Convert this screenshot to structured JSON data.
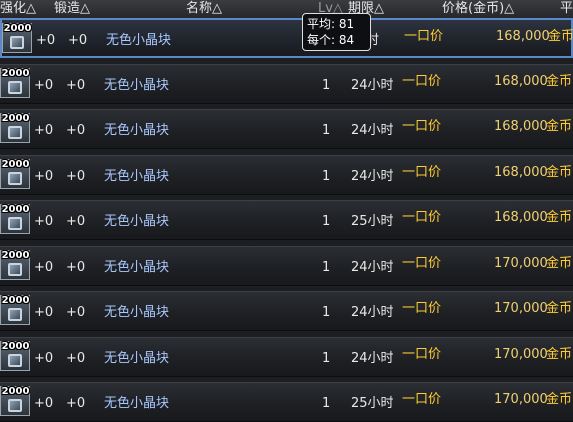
{
  "header": {
    "enhance": "强化△",
    "forge": "锻造△",
    "name": "名称△",
    "level": "Lv△",
    "duration": "期限△",
    "price": "价格(金币)△",
    "extra": "平"
  },
  "tooltip": {
    "avg_label": "平均",
    "avg_value": ": 81",
    "each_label": "每个",
    "each_value": ": 84"
  },
  "rows": [
    {
      "qty": "2000",
      "enhance": "+0",
      "forge": "+0",
      "name": "无色小晶块",
      "level": "",
      "duration": "小时",
      "type": "一口价",
      "price": "168,000",
      "currency": "金币"
    },
    {
      "qty": "2000",
      "enhance": "+0",
      "forge": "+0",
      "name": "无色小晶块",
      "level": "1",
      "duration": "24小时",
      "type": "一口价",
      "price": "168,000",
      "currency": "金币"
    },
    {
      "qty": "2000",
      "enhance": "+0",
      "forge": "+0",
      "name": "无色小晶块",
      "level": "1",
      "duration": "24小时",
      "type": "一口价",
      "price": "168,000",
      "currency": "金币"
    },
    {
      "qty": "2000",
      "enhance": "+0",
      "forge": "+0",
      "name": "无色小晶块",
      "level": "1",
      "duration": "24小时",
      "type": "一口价",
      "price": "168,000",
      "currency": "金币"
    },
    {
      "qty": "2000",
      "enhance": "+0",
      "forge": "+0",
      "name": "无色小晶块",
      "level": "1",
      "duration": "25小时",
      "type": "一口价",
      "price": "168,000",
      "currency": "金币"
    },
    {
      "qty": "2000",
      "enhance": "+0",
      "forge": "+0",
      "name": "无色小晶块",
      "level": "1",
      "duration": "24小时",
      "type": "一口价",
      "price": "170,000",
      "currency": "金币"
    },
    {
      "qty": "2000",
      "enhance": "+0",
      "forge": "+0",
      "name": "无色小晶块",
      "level": "1",
      "duration": "24小时",
      "type": "一口价",
      "price": "170,000",
      "currency": "金币"
    },
    {
      "qty": "2000",
      "enhance": "+0",
      "forge": "+0",
      "name": "无色小晶块",
      "level": "1",
      "duration": "24小时",
      "type": "一口价",
      "price": "170,000",
      "currency": "金币"
    },
    {
      "qty": "2000",
      "enhance": "+0",
      "forge": "+0",
      "name": "无色小晶块",
      "level": "1",
      "duration": "25小时",
      "type": "一口价",
      "price": "170,000",
      "currency": "金币"
    }
  ]
}
